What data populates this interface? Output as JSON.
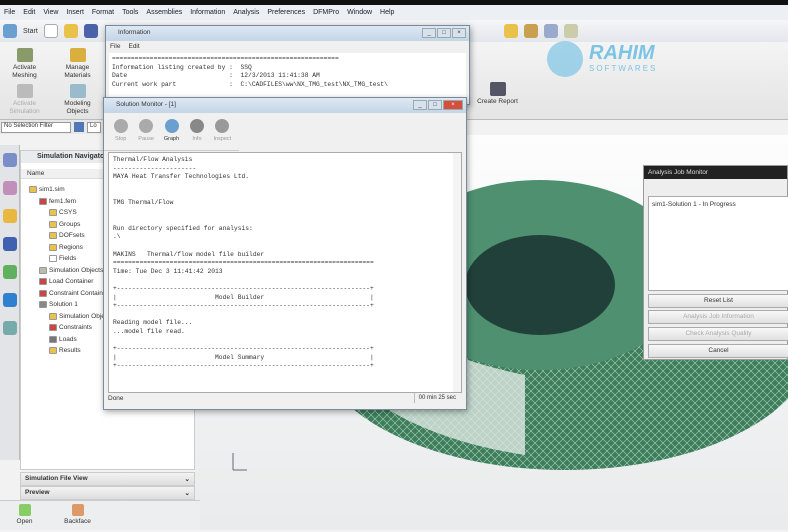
{
  "menu": [
    "File",
    "Edit",
    "View",
    "Insert",
    "Format",
    "Tools",
    "Assemblies",
    "Information",
    "Analysis",
    "Preferences",
    "DFMPro",
    "Window",
    "Help"
  ],
  "toolbar": {
    "start": "Start"
  },
  "ribbon": {
    "activate_meshing": "Activate Meshing",
    "manage_materials": "Manage Materials",
    "activate_simulation": "Activate Simulation",
    "modeling_objects": "Modeling Objects",
    "create_report": "Create Report"
  },
  "selection": {
    "filter": "No Selection Filter",
    "second": "Lo"
  },
  "navigator": {
    "title": "Simulation Navigator",
    "column": "Name",
    "items": [
      "sim1.sim",
      "fem1.fem",
      "CSYS",
      "Groups",
      "DOFsets",
      "Regions",
      "Fields",
      "Simulation Objects",
      "Load Container",
      "Constraint Container",
      "Solution 1",
      "Simulation Objects",
      "Constraints",
      "Loads",
      "Results"
    ]
  },
  "panels": {
    "file_view": "Simulation File View",
    "preview": "Preview"
  },
  "bottom": {
    "open": "Open",
    "backface": "Backface"
  },
  "info_window": {
    "title": "Information",
    "menu": [
      "File",
      "Edit"
    ],
    "lines": [
      "============================================================",
      "Information listing created by :  SSQ",
      "Date                           :  12/3/2013 11:41:38 AM",
      "Current work part              :  C:\\CADFILES\\ww\\NX_TMG_test\\NX_TMG_test\\"
    ]
  },
  "solution_monitor": {
    "title": "Solution Monitor - [1]",
    "tools": [
      "Stop",
      "Pause",
      "Graph",
      "Info",
      "Inspect"
    ],
    "lines": [
      "Thermal/Flow Analysis",
      "----------------------",
      "MAYA Heat Transfer Technologies Ltd.",
      "",
      "",
      "TMG Thermal/Flow",
      "",
      "",
      "Run directory specified for analysis:",
      ".\\",
      "",
      "MAKINS   Thermal/flow model file builder",
      "=====================================================================",
      "Time: Tue Dec 3 11:41:42 2013",
      "",
      "+-------------------------------------------------------------------+",
      "|                          Model Builder                            |",
      "+-------------------------------------------------------------------+",
      "",
      "Reading model file...",
      "...model file read.",
      "",
      "+-------------------------------------------------------------------+",
      "|                          Model Summary                            |",
      "+-------------------------------------------------------------------+"
    ],
    "status": "Done",
    "elapsed": "00 min 25 sec"
  },
  "job_monitor": {
    "title": "Analysis Job Monitor",
    "jobs": [
      "sim1-Solution 1 - In Progress"
    ],
    "reset": "Reset List",
    "info": "Analysis Job Information",
    "quality": "Check Analysis Quality",
    "cancel": "Cancel"
  },
  "watermark": {
    "name": "RAHIM",
    "sub": "SOFTWARES"
  },
  "colors": {
    "mesh": "#3f7d5c",
    "title": "#c4d5e8",
    "accent": "#5ab0d8"
  }
}
